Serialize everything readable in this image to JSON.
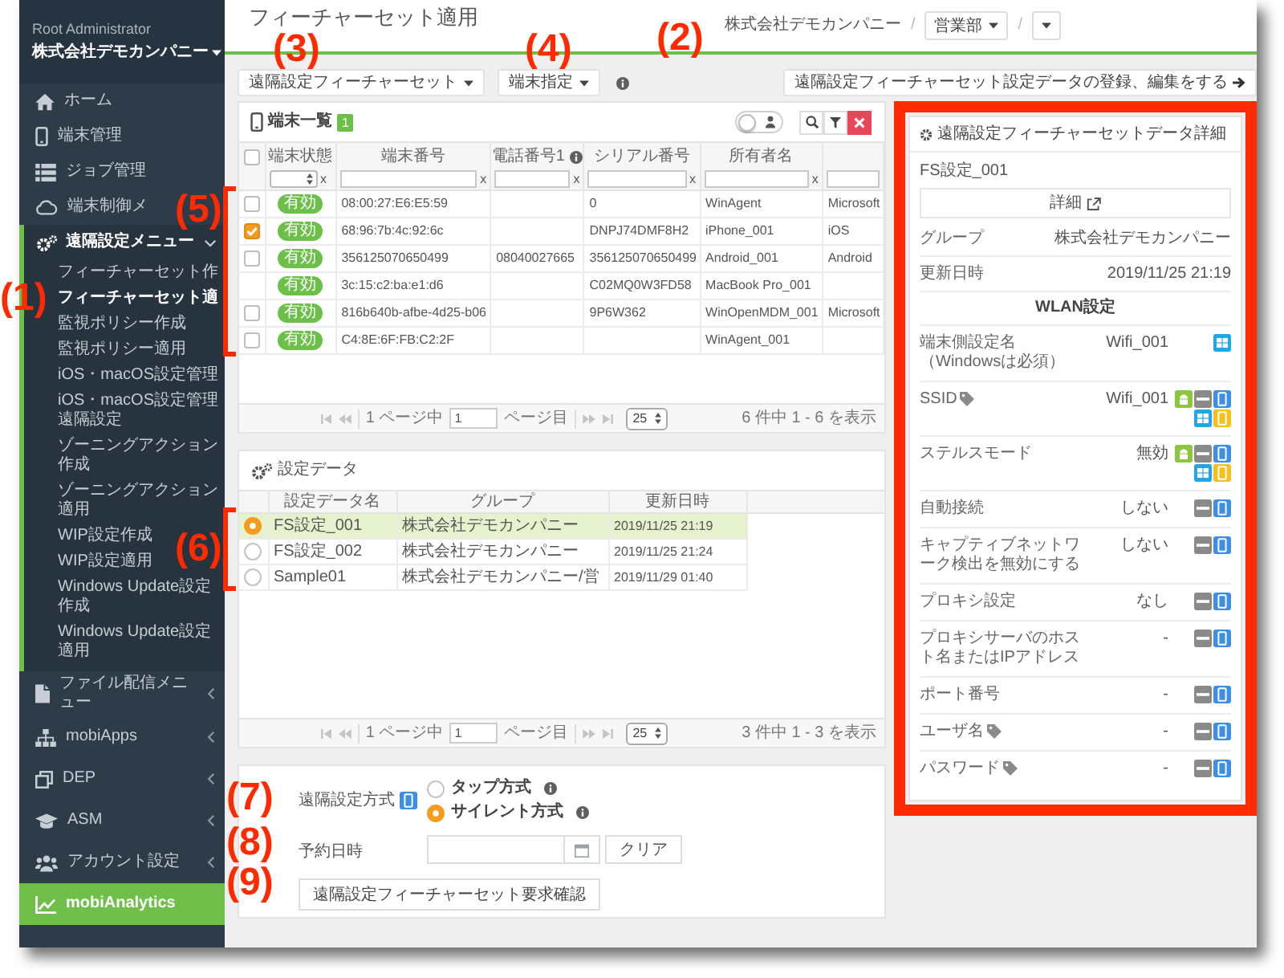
{
  "sidebar": {
    "user": "Root Administrator",
    "company": "株式会社デモカンパニー",
    "items": [
      {
        "kind": "link",
        "label": "ホーム"
      },
      {
        "kind": "link",
        "label": "端末管理"
      },
      {
        "kind": "link",
        "label": "ジョブ管理"
      },
      {
        "kind": "link",
        "label": "端末制御メ"
      },
      {
        "kind": "menu",
        "label": "遠隔設定メニュー",
        "expanded": true,
        "children": [
          {
            "label": "フィーチャーセット作",
            "selected": false
          },
          {
            "label": "フィーチャーセット適",
            "selected": true
          },
          {
            "label": "監視ポリシー作成",
            "selected": false
          },
          {
            "label": "監視ポリシー適用",
            "selected": false
          },
          {
            "label": "iOS・macOS設定管理",
            "selected": false
          },
          {
            "label": "iOS・macOS設定管理遠隔設定",
            "selected": false
          },
          {
            "label": "ゾーニングアクション作成",
            "selected": false
          },
          {
            "label": "ゾーニングアクション適用",
            "selected": false
          },
          {
            "label": "WIP設定作成",
            "selected": false
          },
          {
            "label": "WIP設定適用",
            "selected": false
          },
          {
            "label": "Windows Update設定作成",
            "selected": false
          },
          {
            "label": "Windows Update設定適用",
            "selected": false
          }
        ]
      },
      {
        "kind": "menu",
        "label": "ファイル配信メニュー",
        "expanded": false
      },
      {
        "kind": "menu",
        "label": "mobiApps",
        "expanded": false
      },
      {
        "kind": "menu",
        "label": "DEP",
        "expanded": false
      },
      {
        "kind": "menu",
        "label": "ASM",
        "expanded": false
      },
      {
        "kind": "menu",
        "label": "アカウント設定",
        "expanded": false
      },
      {
        "kind": "accent",
        "label": "mobiAnalytics"
      }
    ]
  },
  "header": {
    "title": "フィーチャーセット適用",
    "breadcrumb": {
      "company": "株式会社デモカンパニー",
      "items": [
        {
          "separator": "/",
          "label": "営業部"
        },
        {
          "separator": "/"
        }
      ]
    }
  },
  "toolbar": {
    "feature_set_button": "遠隔設定フィーチャーセット",
    "device_button": "端末指定",
    "register_button": "遠隔設定フィーチャーセット設定データの登録、編集をする"
  },
  "devices": {
    "title": "端末一覧",
    "count": "1",
    "toggle": {
      "on": false
    },
    "select_all": {
      "checked": false
    },
    "columns": [
      {
        "label": "端末状態",
        "kind": "badge",
        "info": false,
        "filter": {
          "kind": "select",
          "clear": "x"
        }
      },
      {
        "label": "端末番号",
        "kind": "text",
        "info": false,
        "filter": {
          "kind": "input",
          "clear": "x"
        }
      },
      {
        "label": "電話番号1",
        "kind": "text",
        "info": true,
        "filter": {
          "kind": "input",
          "clear": "x"
        }
      },
      {
        "label": "シリアル番号",
        "kind": "text",
        "info": false,
        "filter": {
          "kind": "input",
          "clear": "x"
        }
      },
      {
        "label": "所有者名",
        "kind": "text",
        "info": false,
        "filter": {
          "kind": "input",
          "clear": "x"
        }
      },
      {
        "kind": "text",
        "filter": {
          "kind": "input"
        }
      }
    ],
    "rows": [
      {
        "kind": "checkbox",
        "checked": false,
        "cells": [
          "有効",
          "08:00:27:E6:E5:59",
          null,
          "0",
          "WinAgent",
          "Microsoft"
        ]
      },
      {
        "kind": "checkbox",
        "checked": true,
        "cells": [
          "有効",
          "68:96:7b:4c:92:6c",
          null,
          "DNPJ74DMF8H2",
          "iPhone_001",
          "iOS"
        ]
      },
      {
        "kind": "checkbox",
        "checked": false,
        "cells": [
          "有効",
          "356125070650499",
          "08040027665",
          "356125070650499",
          "Android_001",
          "Android"
        ]
      },
      {
        "kind": "plain",
        "cells": [
          "有効",
          "3c:15:c2:ba:e1:d6",
          null,
          "C02MQ0W3FD58",
          "MacBook Pro_001",
          null
        ]
      },
      {
        "kind": "checkbox",
        "checked": false,
        "cells": [
          "有効",
          "816b640b-afbe-4d25-b06",
          null,
          "9P6W362",
          "WinOpenMDM_001",
          "Microsoft"
        ]
      },
      {
        "kind": "checkbox",
        "checked": false,
        "cells": [
          "有効",
          "C4:8E:6F:FB:C2:2F",
          null,
          null,
          "WinAgent_001",
          null
        ]
      }
    ],
    "pager": {
      "page_prefix": "1 ページ中",
      "page": "1",
      "page_suffix": "ページ目",
      "page_size": "25",
      "summary": "6 件中 1 - 6 を表示"
    }
  },
  "settings": {
    "title": "設定データ",
    "columns": [
      "設定データ名",
      "グループ",
      "更新日時"
    ],
    "rows": [
      {
        "selected": true,
        "name": "FS設定_001",
        "group": "株式会社デモカンパニー",
        "updated": "2019/11/25 21:19"
      },
      {
        "selected": false,
        "name": "FS設定_002",
        "group": "株式会社デモカンパニー",
        "updated": "2019/11/25 21:24"
      },
      {
        "selected": false,
        "name": "Sample01",
        "group": "株式会社デモカンパニー/営",
        "updated": "2019/11/29 01:40"
      }
    ],
    "pager": {
      "page_prefix": "1 ページ中",
      "page": "1",
      "page_suffix": "ページ目",
      "page_size": "25",
      "summary": "3 件中 1 - 3 を表示"
    }
  },
  "form": {
    "method": {
      "label": "遠隔設定方式",
      "options": [
        {
          "label": "タップ方式",
          "selected": false
        },
        {
          "label": "サイレント方式",
          "selected": true
        }
      ]
    },
    "schedule": {
      "label": "予約日時",
      "clear_button": "クリア"
    },
    "submit_button": "遠隔設定フィーチャーセット要求確認"
  },
  "detail_panel": {
    "highlighted": true,
    "title": "遠隔設定フィーチャーセットデータ詳細",
    "name": "FS設定_001",
    "detail_button": "詳細",
    "info_rows": [
      {
        "label": "グループ",
        "value": "株式会社デモカンパニー"
      },
      {
        "label": "更新日時",
        "value": "2019/11/25 21:19"
      }
    ],
    "section_title": "WLAN設定",
    "settings": [
      {
        "label": "端末側設定名（Windowsは必須）",
        "tagged": false,
        "value": "Wifi_001",
        "platforms": [
          {
            "kind": "windows"
          }
        ]
      },
      {
        "label": "SSID",
        "tagged": true,
        "value": "Wifi_001",
        "platforms": [
          {
            "kind": "android"
          },
          {
            "kind": "generic"
          },
          {
            "kind": "ios"
          },
          {
            "kind": "windows"
          },
          {
            "kind": "macos"
          }
        ]
      },
      {
        "label": "ステルスモード",
        "tagged": false,
        "value": "無効",
        "platforms": [
          {
            "kind": "android"
          },
          {
            "kind": "generic"
          },
          {
            "kind": "ios"
          },
          {
            "kind": "windows"
          },
          {
            "kind": "macos"
          }
        ]
      },
      {
        "label": "自動接続",
        "tagged": false,
        "value": "しない",
        "platforms": [
          {
            "kind": "generic"
          },
          {
            "kind": "ios"
          }
        ]
      },
      {
        "label": "キャプティブネットワーク検出を無効にする",
        "tagged": false,
        "value": "しない",
        "platforms": [
          {
            "kind": "generic"
          },
          {
            "kind": "ios"
          }
        ]
      },
      {
        "label": "プロキシ設定",
        "tagged": false,
        "value": "なし",
        "platforms": [
          {
            "kind": "generic"
          },
          {
            "kind": "ios"
          }
        ]
      },
      {
        "label": "プロキシサーバのホスト名またはIPアドレス",
        "tagged": false,
        "value": "-",
        "platforms": [
          {
            "kind": "generic"
          },
          {
            "kind": "ios"
          }
        ]
      },
      {
        "label": "ポート番号",
        "tagged": false,
        "value": "-",
        "platforms": [
          {
            "kind": "generic"
          },
          {
            "kind": "ios"
          }
        ]
      },
      {
        "label": "ユーザ名",
        "tagged": true,
        "value": "-",
        "platforms": [
          {
            "kind": "generic"
          },
          {
            "kind": "ios"
          }
        ]
      },
      {
        "label": "パスワード",
        "tagged": true,
        "value": "-",
        "platforms": [
          {
            "kind": "generic"
          },
          {
            "kind": "ios"
          }
        ]
      }
    ]
  },
  "annotations": [
    {
      "kind": "label",
      "text": "(3)"
    },
    {
      "kind": "label",
      "text": "(4)"
    },
    {
      "kind": "label",
      "text": "(2)"
    },
    {
      "kind": "bracket",
      "text": "(5)"
    },
    {
      "kind": "label",
      "text": "(1)"
    },
    {
      "kind": "bracket",
      "text": "(6)"
    },
    {
      "kind": "label",
      "text": "(7)"
    },
    {
      "kind": "label",
      "text": "(8)"
    },
    {
      "kind": "label",
      "text": "(9)"
    }
  ]
}
